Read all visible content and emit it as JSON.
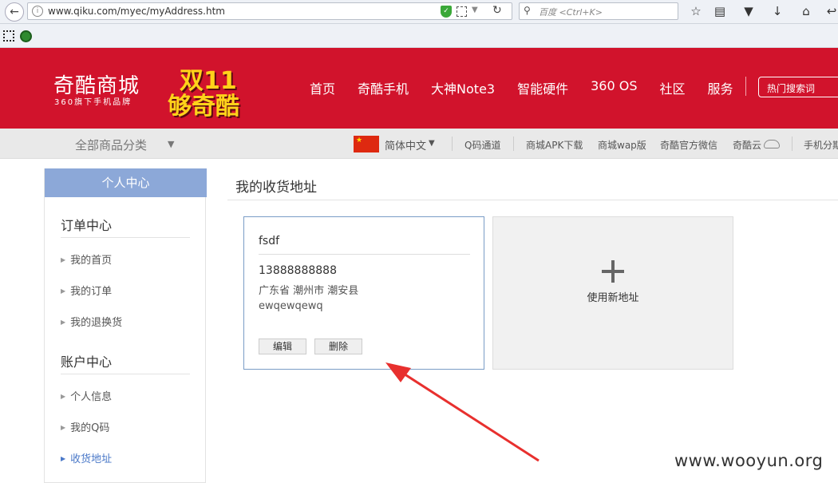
{
  "browser": {
    "url": "www.qiku.com/myec/myAddress.htm",
    "search_placeholder": "百度 <Ctrl+K>"
  },
  "header": {
    "logo_title": "奇酷商城",
    "logo_subtitle": "360旗下手机品牌",
    "promo_line1": "双11",
    "promo_line2": "够奇酷",
    "nav": [
      "首页",
      "奇酷手机",
      "大神Note3",
      "智能硬件",
      "360 OS",
      "社区",
      "服务"
    ],
    "hot_search": "热门搜索词"
  },
  "subnav": {
    "categories": "全部商品分类",
    "language": "简体中文",
    "links": [
      "Q码通道",
      "商城APK下载",
      "商城wap版",
      "奇酷官方微信",
      "奇酷云",
      "手机分期"
    ]
  },
  "sidebar": {
    "header": "个人中心",
    "order_section": "订单中心",
    "order_items": [
      "我的首页",
      "我的订单",
      "我的退换货"
    ],
    "account_section": "账户中心",
    "account_items": [
      "个人信息",
      "我的Q码",
      "收货地址"
    ]
  },
  "main": {
    "title": "我的收货地址",
    "address": {
      "name": "fsdf",
      "phone": "13888888888",
      "region": "广东省 潮州市 潮安县",
      "detail": "ewqewqewq",
      "edit_label": "编辑",
      "delete_label": "删除"
    },
    "new_address_label": "使用新地址"
  },
  "watermark": "www.wooyun.org",
  "colors": {
    "brand_red": "#d1132c",
    "sidebar_header": "#8ca8d8",
    "active_link": "#4a78c8",
    "annotation_arrow": "#e8302e"
  }
}
